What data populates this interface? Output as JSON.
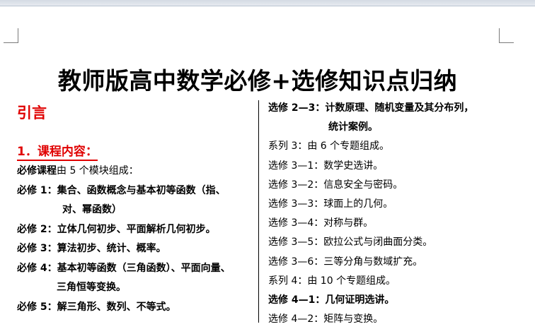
{
  "doc": {
    "title": "教师版高中数学必修+选修知识点归纳",
    "left": {
      "intro": "引言",
      "section": "1．课程内容：",
      "lead_bold": "必修课程",
      "lead_rest": "由 5 个模块组成：",
      "items": [
        {
          "label": "必修 1：",
          "text": "集合、函数概念与基本初等函数（指、",
          "cont": "对、幂函数）"
        },
        {
          "label": "必修 2：",
          "text": "立体几何初步、平面解析几何初步。"
        },
        {
          "label": "必修 3：",
          "text": "算法初步、统计、概率。"
        },
        {
          "label": "必修 4：",
          "text": "基本初等函数（三角函数）、平面向量、",
          "cont": "三角恒等变换。"
        },
        {
          "label": "必修 5：",
          "text": "解三角形、数列、不等式。"
        }
      ]
    },
    "right": {
      "l1": "选修 2—3：计数原理、随机变量及其分布列，",
      "l1_cont": "统计案例。",
      "l2": "系列 3：由 6 个专题组成。",
      "l3": "选修 3—1：数学史选讲。",
      "l4": "选修 3—2：信息安全与密码。",
      "l5": "选修 3—3：球面上的几何。",
      "l6": "选修 3—4：对称与群。",
      "l7": "选修 3—5：欧拉公式与闭曲面分类。",
      "l8": "选修 3—6：三等分角与数域扩充。",
      "l9": "系列 4：由 10 个专题组成。",
      "l10": "选修 4—1：几何证明选讲。",
      "l11": "选修 4—2：矩阵与变换。"
    }
  }
}
